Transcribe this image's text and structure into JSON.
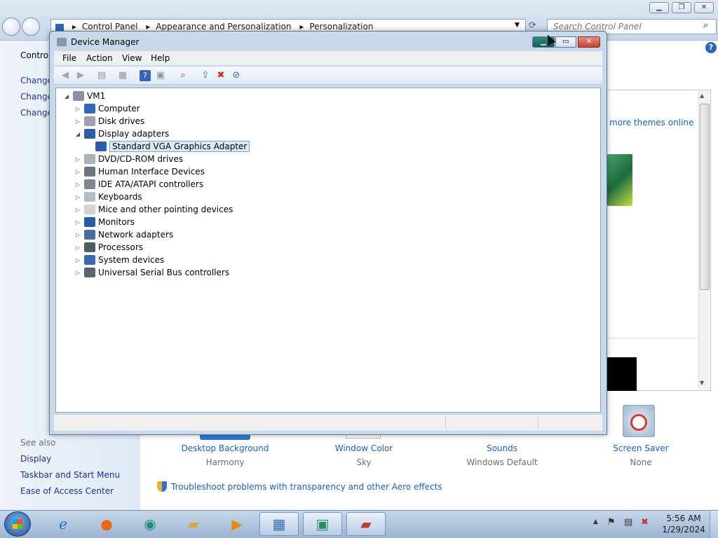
{
  "background_window": {
    "breadcrumb": [
      "Control Panel",
      "Appearance and Personalization",
      "Personalization"
    ],
    "search_placeholder": "Search Control Panel",
    "left_pane": {
      "title": "Control",
      "links": [
        "Change",
        "Change",
        "Change"
      ],
      "see_also_label": "See also",
      "see_also_links": [
        "Display",
        "Taskbar and Start Menu",
        "Ease of Access Center"
      ]
    },
    "themes_link": "more themes online",
    "cards": [
      {
        "label": "Desktop Background",
        "sub": "Harmony"
      },
      {
        "label": "Window Color",
        "sub": "Sky"
      },
      {
        "label": "Sounds",
        "sub": "Windows Default"
      },
      {
        "label": "Screen Saver",
        "sub": "None"
      }
    ],
    "troubleshoot_link": "Troubleshoot problems with transparency and other Aero effects"
  },
  "device_manager": {
    "title": "Device Manager",
    "menu": [
      "File",
      "Action",
      "View",
      "Help"
    ],
    "root": "VM1",
    "tree": [
      {
        "label": "Computer",
        "expanded": false,
        "icon": "computer-icon"
      },
      {
        "label": "Disk drives",
        "expanded": false,
        "icon": "disk-drive-icon"
      },
      {
        "label": "Display adapters",
        "expanded": true,
        "icon": "display-adapter-icon"
      },
      {
        "label": "Standard VGA Graphics Adapter",
        "child": true,
        "selected": true,
        "icon": "display-adapter-icon"
      },
      {
        "label": "DVD/CD-ROM drives",
        "expanded": false,
        "icon": "dvd-drive-icon"
      },
      {
        "label": "Human Interface Devices",
        "expanded": false,
        "icon": "hid-icon"
      },
      {
        "label": "IDE ATA/ATAPI controllers",
        "expanded": false,
        "icon": "ide-controller-icon"
      },
      {
        "label": "Keyboards",
        "expanded": false,
        "icon": "keyboard-icon"
      },
      {
        "label": "Mice and other pointing devices",
        "expanded": false,
        "icon": "mouse-icon"
      },
      {
        "label": "Monitors",
        "expanded": false,
        "icon": "monitor-icon"
      },
      {
        "label": "Network adapters",
        "expanded": false,
        "icon": "network-adapter-icon"
      },
      {
        "label": "Processors",
        "expanded": false,
        "icon": "processor-icon"
      },
      {
        "label": "System devices",
        "expanded": false,
        "icon": "system-device-icon"
      },
      {
        "label": "Universal Serial Bus controllers",
        "expanded": false,
        "icon": "usb-icon"
      }
    ]
  },
  "taskbar": {
    "time": "5:56 AM",
    "date": "1/29/2024"
  },
  "colors": {
    "link": "#1e5eb0",
    "selection": "#dce9f8",
    "close_button": "#c7442f"
  }
}
